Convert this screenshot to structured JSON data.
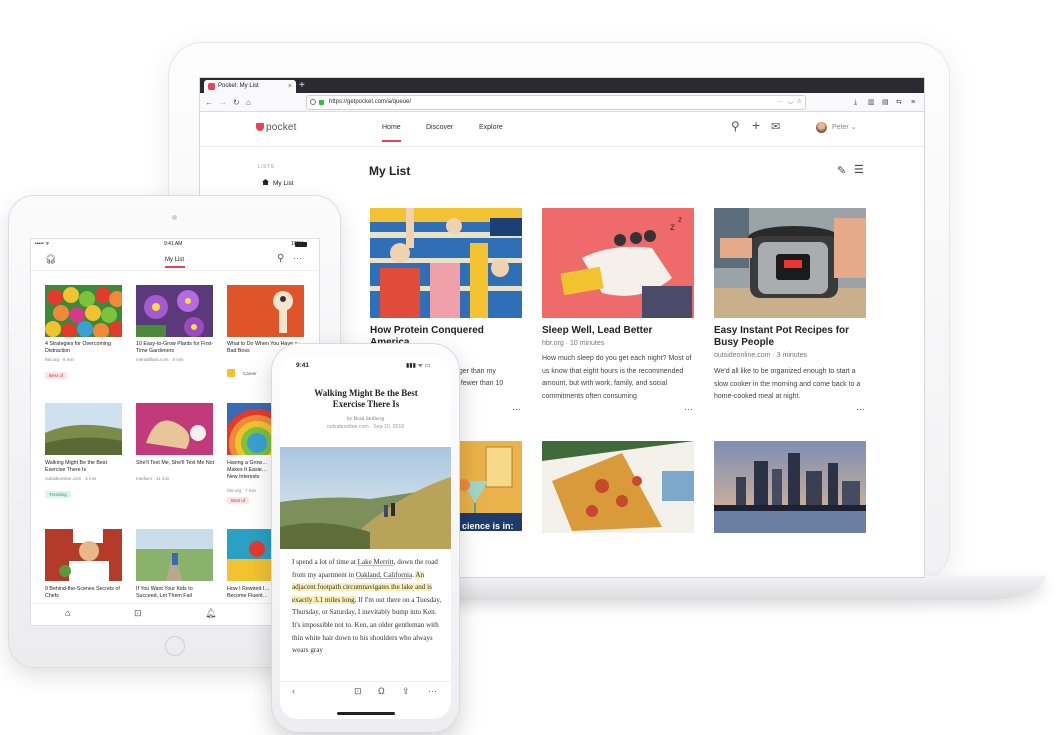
{
  "browser": {
    "tab_title": "Pocket: My List",
    "new_tab_symbol": "+",
    "url": "https://getpocket.com/a/queue/"
  },
  "header": {
    "logo_text": "pocket",
    "nav": [
      {
        "label": "Home"
      },
      {
        "label": "Discover"
      },
      {
        "label": "Explore"
      }
    ],
    "user_name": "Peter",
    "brand_color": "#ef4056"
  },
  "sidebar": {
    "heading": "LISTS",
    "items": [
      {
        "label": "My List"
      }
    ]
  },
  "main": {
    "title": "My List",
    "cards": [
      {
        "title": "How Protein Conquered America",
        "source": "",
        "excerpt": "",
        "excerpt_fragment": [
          "gger than my",
          "o fewer than 10"
        ]
      },
      {
        "title": "Sleep Well, Lead Better",
        "source": "hbr.org · 10 minutes",
        "excerpt": "How much sleep do you get each night? Most of us know that eight hours is the recommended amount, but with work, family, and social commitments often consuming"
      },
      {
        "title": "Easy Instant Pot Recipes for Busy People",
        "source": "outsideonline.com · 3 minutes",
        "excerpt": "We'd all like to be organized enough to start a slow cooker in the morning and come back to a home-cooked meal at night."
      }
    ],
    "partial_card_text": "cience is in:"
  },
  "tablet": {
    "time": "9:41 AM",
    "battery": "100%",
    "title": "My List",
    "items": [
      {
        "title": "4 Strategies for Overcoming Distraction",
        "source": "hbr.org · 6 min",
        "badge": "Best of"
      },
      {
        "title": "10 Easy-to-Grow Plants for First-Time Gardeners",
        "source": "mentalfloss.com · 8 min",
        "badge": ""
      },
      {
        "title": "What to Do When You Have a Bad Boss",
        "source": "",
        "badge": "Career"
      },
      {
        "title": "Walking Might Be the Best Exercise There Is",
        "source": "outsideonline.com · 5 min",
        "badge": "Trending"
      },
      {
        "title": "She'll Text Me, She'll Text Me Not",
        "source": "medium · 11 min",
        "badge": ""
      },
      {
        "title": "Having a Grow… Makes It Easie… New Interests",
        "source": "hbr.org · 7 min",
        "badge": "Best of"
      },
      {
        "title": "9 Behind-the-Scenes Secrets of Chefs",
        "source": "",
        "badge": ""
      },
      {
        "title": "If You Want Your Kids to Succeed, Let Them Fail",
        "source": "",
        "badge": ""
      },
      {
        "title": "How I Rewired I… Become Fluent…",
        "source": "",
        "badge": ""
      }
    ]
  },
  "phone": {
    "time": "9:41",
    "article_title": "Walking Might Be the Best Exercise There Is",
    "byline": "by Brad Stulberg",
    "meta": "outsideonline.com · Sep 10, 2018",
    "body": {
      "p1": "I spend a lot of time at ",
      "link1": "Lake Merritt",
      "p2": ", down the road from my apartment in ",
      "link2": "Oakland, California",
      "p3": ". ",
      "highlight": "An adjacent footpath circumnavigates the lake and is exactly 3.1 miles long.",
      "p4": " If I'm out there on a Tuesday, Thursday, or Saturday, I inevitably bump into Ken. It's impossible not to. Ken, an older gentleman with thin white hair down to his shoulders who always wears gray"
    }
  }
}
